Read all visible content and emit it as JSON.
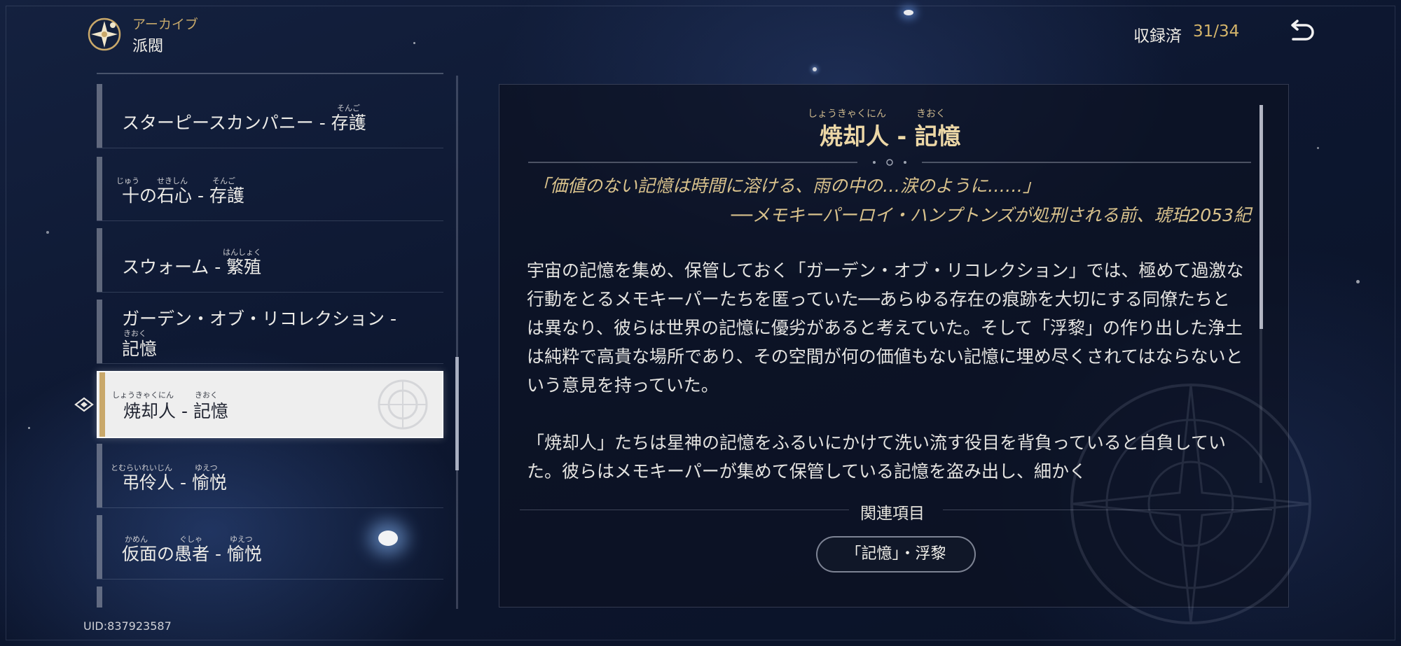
{
  "header": {
    "subtitle": "アーカイブ",
    "title": "派閥",
    "collected_label": "収録済",
    "collected_value": "31/34"
  },
  "list": {
    "items": [
      {
        "text": "スターピースカンパニー - 存護",
        "ruby": [
          {
            "text": "そんご"
          }
        ]
      },
      {
        "text": "十の石心 - 存護",
        "ruby": [
          {
            "text": "じゅう"
          },
          {
            "text": "せきしん"
          },
          {
            "text": "そんご"
          }
        ]
      },
      {
        "text": "スウォーム - 繁殖",
        "ruby": [
          {
            "text": "はんしょく"
          }
        ]
      },
      {
        "line1": "ガーデン・オブ・リコレクション -",
        "line2": "記憶",
        "ruby": [
          {
            "text": "きおく"
          }
        ]
      },
      {
        "text": "焼却人 - 記憶",
        "ruby": [
          {
            "text": "しょうきゃくにん"
          },
          {
            "text": "きおく"
          }
        ],
        "selected": true
      },
      {
        "text": "弔伶人 - 愉悦",
        "ruby": [
          {
            "text": "とむらいれいじん"
          },
          {
            "text": "ゆえつ"
          }
        ]
      },
      {
        "text": "仮面の愚者 - 愉悦",
        "ruby": [
          {
            "text": "かめん"
          },
          {
            "text": "ぐしゃ"
          },
          {
            "text": "ゆえつ"
          }
        ]
      }
    ]
  },
  "detail": {
    "title": "焼却人 - 記憶",
    "title_ruby": [
      "しょうきゃくにん",
      "きおく"
    ],
    "quote_line1": "「価値のない記憶は時間に溶ける、雨の中の…涙のように……」",
    "quote_line2": "──メモキーパーロイ・ハンプトンズが処刑される前、琥珀2053紀",
    "paragraph1": "宇宙の記憶を集め、保管しておく「ガーデン・オブ・リコレクション」では、極めて過激な行動をとるメモキーパーたちを匿っていた──あらゆる存在の痕跡を大切にする同僚たちとは異なり、彼らは世界の記憶に優劣があると考えていた。そして「浮黎」の作り出した浄土は純粋で高貴な場所であり、その空間が何の価値もない記憶に埋め尽くされてはならないという意見を持っていた。",
    "paragraph2": "「焼却人」たちは星神の記憶をふるいにかけて洗い流す役目を背負っていると自負していた。彼らはメモキーパーが集めて保管している記憶を盗み出し、細かく",
    "related_label": "関連項目",
    "related_items": [
      "「記憶」・浮黎"
    ]
  },
  "footer": {
    "uid": "UID:837923587"
  },
  "colors": {
    "accent_gold": "#d4b46a",
    "selected_bg": "#eeeeee",
    "background": "#0d1730"
  },
  "icons": [
    "archive-emblem-icon",
    "back-arrow-icon",
    "selection-cursor-icon"
  ]
}
